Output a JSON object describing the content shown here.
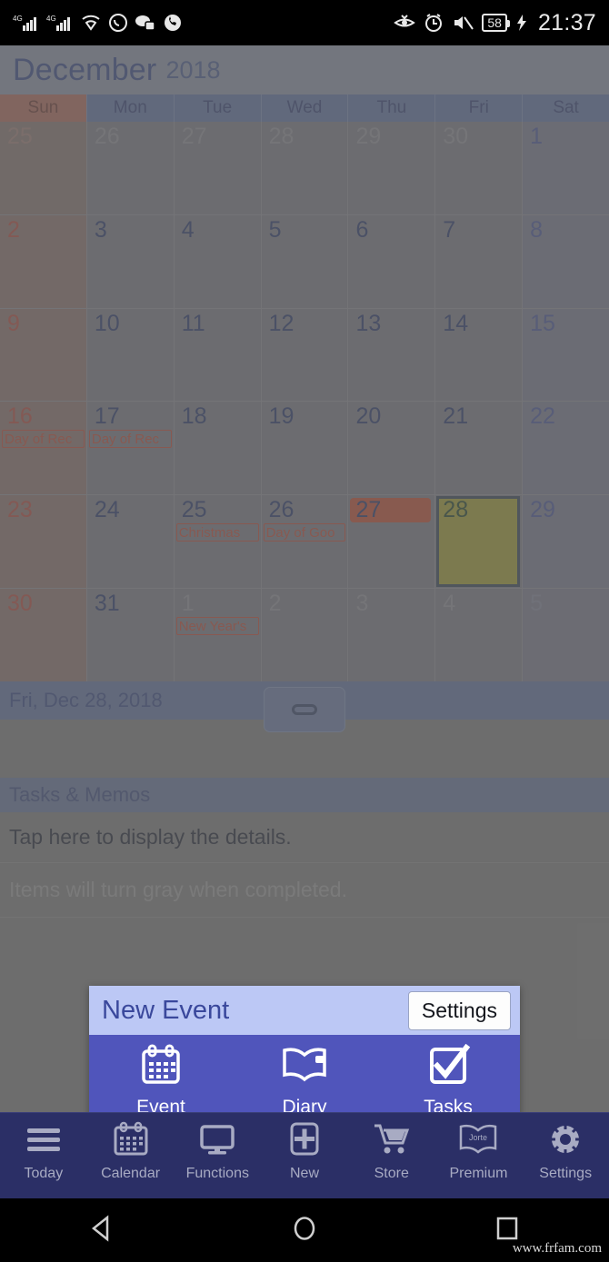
{
  "statusbar": {
    "left_icons": [
      "4g-signal-icon",
      "4g-signal-icon-2",
      "wifi-icon",
      "whatsapp-icon",
      "messaging-icon",
      "phone-call-icon"
    ],
    "right_icons": [
      "eye-comfort-icon",
      "alarm-icon",
      "mute-icon"
    ],
    "battery_level": "58",
    "time": "21:37"
  },
  "header": {
    "month": "December",
    "year": "2018"
  },
  "weekdays": [
    {
      "label": "Sun",
      "type": "sun"
    },
    {
      "label": "Mon",
      "type": "wd"
    },
    {
      "label": "Tue",
      "type": "wd"
    },
    {
      "label": "Wed",
      "type": "wd"
    },
    {
      "label": "Thu",
      "type": "wd"
    },
    {
      "label": "Fri",
      "type": "wd"
    },
    {
      "label": "Sat",
      "type": "wd"
    }
  ],
  "calendar": {
    "weeks": [
      [
        {
          "day": "25",
          "out": true,
          "col": "sun",
          "events": []
        },
        {
          "day": "26",
          "out": true,
          "col": "",
          "events": []
        },
        {
          "day": "27",
          "out": true,
          "col": "",
          "events": []
        },
        {
          "day": "28",
          "out": true,
          "col": "",
          "events": []
        },
        {
          "day": "29",
          "out": true,
          "col": "",
          "events": []
        },
        {
          "day": "30",
          "out": true,
          "col": "",
          "events": []
        },
        {
          "day": "1",
          "out": false,
          "col": "sat",
          "events": []
        }
      ],
      [
        {
          "day": "2",
          "out": false,
          "col": "sun",
          "events": []
        },
        {
          "day": "3",
          "out": false,
          "col": "",
          "events": []
        },
        {
          "day": "4",
          "out": false,
          "col": "",
          "events": []
        },
        {
          "day": "5",
          "out": false,
          "col": "",
          "events": []
        },
        {
          "day": "6",
          "out": false,
          "col": "",
          "events": []
        },
        {
          "day": "7",
          "out": false,
          "col": "",
          "events": []
        },
        {
          "day": "8",
          "out": false,
          "col": "sat",
          "events": []
        }
      ],
      [
        {
          "day": "9",
          "out": false,
          "col": "sun",
          "events": []
        },
        {
          "day": "10",
          "out": false,
          "col": "",
          "events": []
        },
        {
          "day": "11",
          "out": false,
          "col": "",
          "events": []
        },
        {
          "day": "12",
          "out": false,
          "col": "",
          "events": []
        },
        {
          "day": "13",
          "out": false,
          "col": "",
          "events": []
        },
        {
          "day": "14",
          "out": false,
          "col": "",
          "events": []
        },
        {
          "day": "15",
          "out": false,
          "col": "sat",
          "events": []
        }
      ],
      [
        {
          "day": "16",
          "out": false,
          "col": "sun",
          "events": [
            "Day of Rec"
          ]
        },
        {
          "day": "17",
          "out": false,
          "col": "",
          "events": [
            "Day of Rec"
          ]
        },
        {
          "day": "18",
          "out": false,
          "col": "",
          "events": []
        },
        {
          "day": "19",
          "out": false,
          "col": "",
          "events": []
        },
        {
          "day": "20",
          "out": false,
          "col": "",
          "events": []
        },
        {
          "day": "21",
          "out": false,
          "col": "",
          "events": []
        },
        {
          "day": "22",
          "out": false,
          "col": "sat",
          "events": []
        }
      ],
      [
        {
          "day": "23",
          "out": false,
          "col": "sun",
          "events": []
        },
        {
          "day": "24",
          "out": false,
          "col": "",
          "events": []
        },
        {
          "day": "25",
          "out": false,
          "col": "",
          "events": [
            "Christmas"
          ],
          "holiday": true
        },
        {
          "day": "26",
          "out": false,
          "col": "",
          "events": [
            "Day of Goo"
          ],
          "holiday": true
        },
        {
          "day": "27",
          "out": false,
          "col": "",
          "events": [],
          "today": true
        },
        {
          "day": "28",
          "out": false,
          "col": "",
          "events": [],
          "selected": true
        },
        {
          "day": "29",
          "out": false,
          "col": "sat",
          "events": []
        }
      ],
      [
        {
          "day": "30",
          "out": false,
          "col": "sun",
          "events": []
        },
        {
          "day": "31",
          "out": false,
          "col": "",
          "events": []
        },
        {
          "day": "1",
          "out": true,
          "col": "",
          "events": [
            "New Year's"
          ],
          "holiday": true
        },
        {
          "day": "2",
          "out": true,
          "col": "",
          "events": []
        },
        {
          "day": "3",
          "out": true,
          "col": "",
          "events": []
        },
        {
          "day": "4",
          "out": true,
          "col": "",
          "events": []
        },
        {
          "day": "5",
          "out": true,
          "col": "sat",
          "events": []
        }
      ]
    ]
  },
  "datebar": {
    "selected_date": "Fri, Dec 28, 2018"
  },
  "tasks": {
    "section_title": "Tasks & Memos",
    "row1": "Tap here to display the details.",
    "row2": "Items will turn gray when completed."
  },
  "popup": {
    "title": "New Event",
    "settings_label": "Settings",
    "items": [
      {
        "label": "Event",
        "icon": "calendar-icon"
      },
      {
        "label": "Diary",
        "icon": "book-icon"
      },
      {
        "label": "Tasks",
        "icon": "checkbox-checked-icon"
      }
    ]
  },
  "bottomnav": [
    {
      "label": "Today",
      "icon": "hamburger-icon"
    },
    {
      "label": "Calendar",
      "icon": "calendar-icon"
    },
    {
      "label": "Functions",
      "icon": "monitor-icon"
    },
    {
      "label": "New",
      "icon": "plus-box-icon"
    },
    {
      "label": "Store",
      "icon": "cart-icon"
    },
    {
      "label": "Premium",
      "icon": "jorte-book-icon"
    },
    {
      "label": "Settings",
      "icon": "gear-icon"
    }
  ],
  "androidnav": [
    {
      "icon": "back-triangle-icon"
    },
    {
      "icon": "home-circle-icon"
    },
    {
      "icon": "recents-square-icon"
    }
  ],
  "watermark": "www.frfam.com",
  "colors": {
    "accent_blue": "#2f3f77",
    "header_bg": "#7b8193",
    "weekday_bg": "#53658f",
    "sunday_bg": "#9a5b4e",
    "today_red": "#a8432c",
    "selected_yellow": "#8f8b2a",
    "event_red": "#a8422f",
    "popup_head_bg": "#bcc8f5",
    "popup_body_bg": "#5055bb",
    "botnav_bg": "#2b2f66"
  }
}
